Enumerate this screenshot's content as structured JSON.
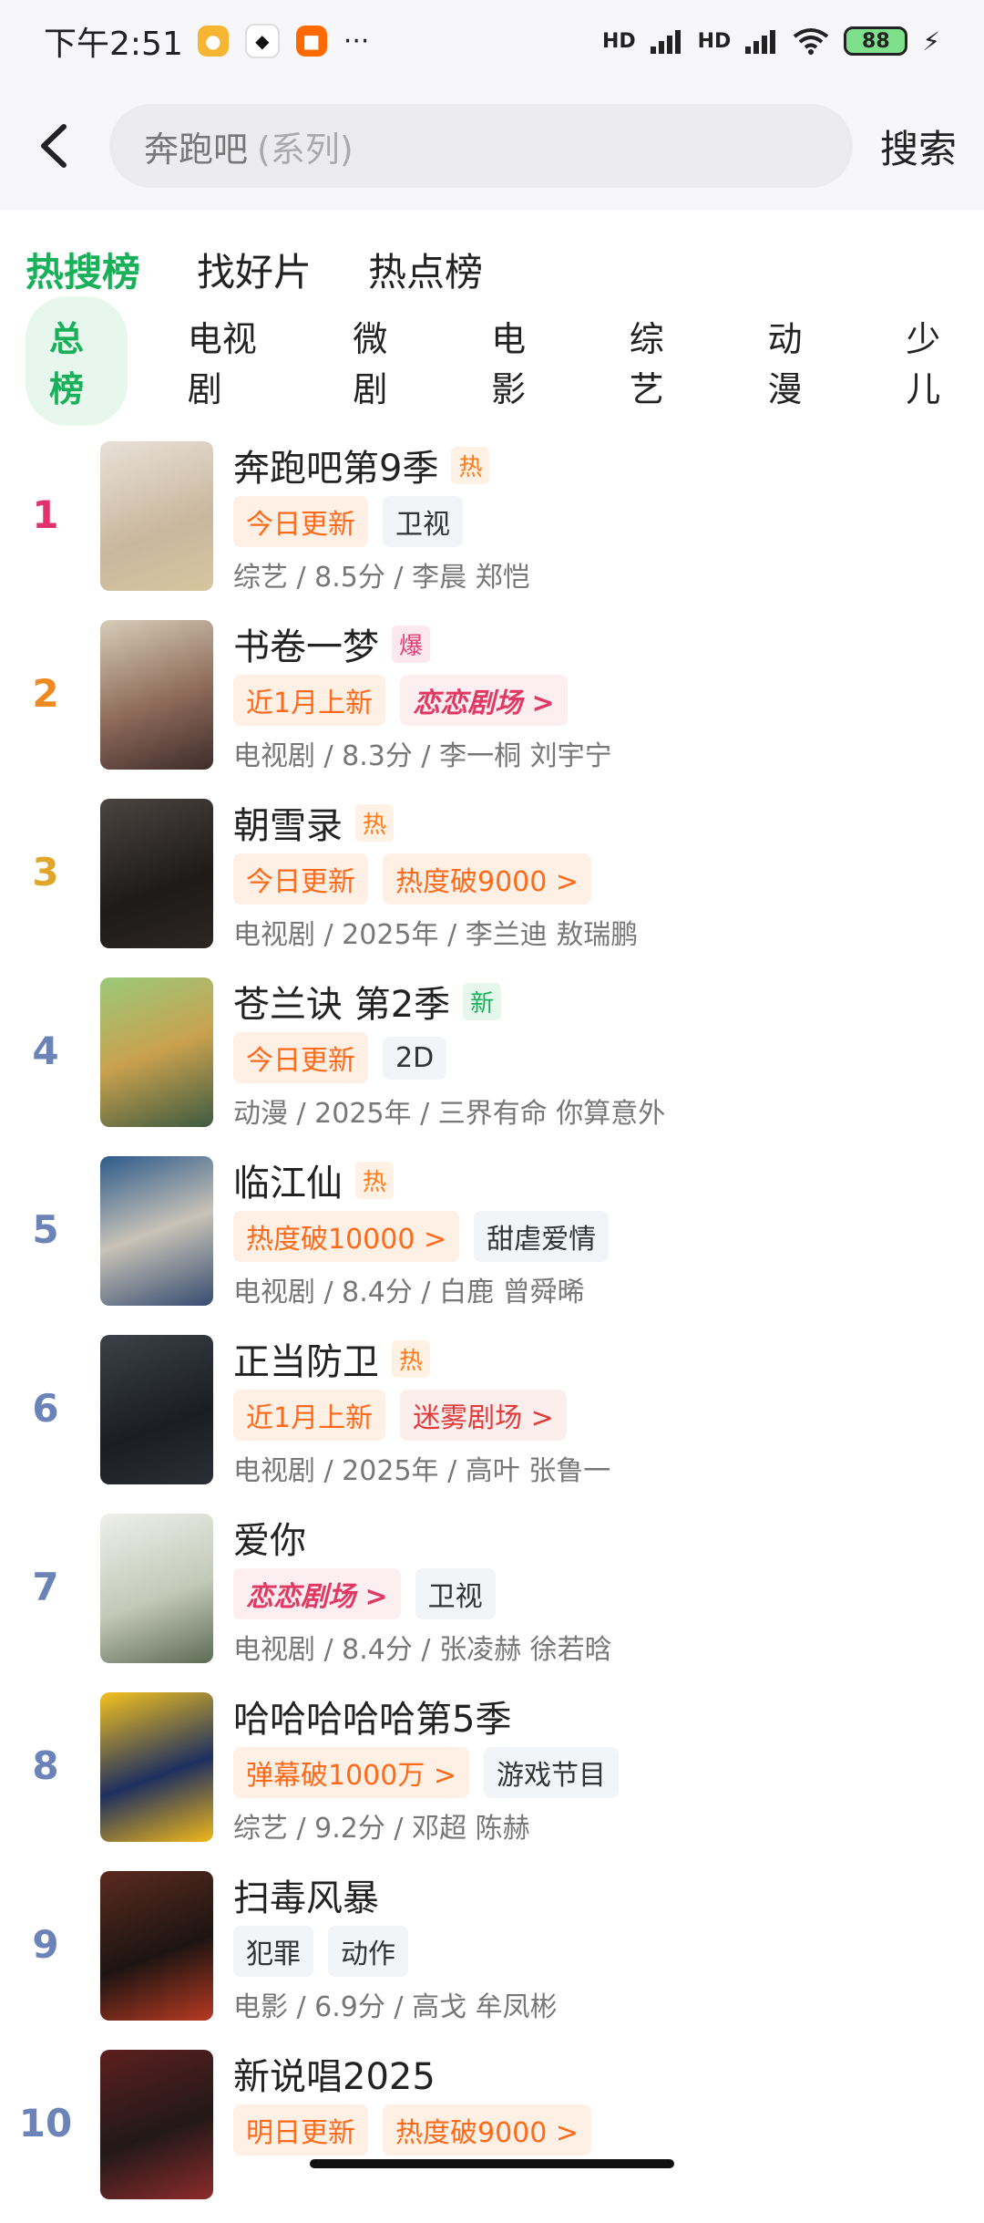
{
  "status_bar": {
    "time": "下午2:51",
    "battery": "88",
    "signal_hd1": "HD",
    "signal_hd2": "HD",
    "icons": [
      "weibo-icon",
      "qq-icon",
      "mi-icon",
      "more-icon",
      "signal-icon",
      "wifi-icon",
      "battery-icon",
      "charging-icon"
    ]
  },
  "search": {
    "query": "奔跑吧",
    "suffix": "(系列)",
    "button": "搜索"
  },
  "top_tabs": [
    "热搜榜",
    "找好片",
    "热点榜"
  ],
  "category_tabs": [
    "总榜",
    "电视剧",
    "微剧",
    "电影",
    "综艺",
    "动漫",
    "少儿"
  ],
  "list": [
    {
      "rank": "1",
      "title": "奔跑吧第9季",
      "badge": "热",
      "tags": [
        {
          "text": "今日更新",
          "style": "orange"
        },
        {
          "text": "卫视",
          "style": "gray"
        }
      ],
      "meta": "综艺 / 8.5分 / 李晨 郑恺"
    },
    {
      "rank": "2",
      "title": "书卷一梦",
      "badge": "爆",
      "tags": [
        {
          "text": "近1月上新",
          "style": "orange"
        },
        {
          "text": "恋恋剧场 >",
          "style": "pink"
        }
      ],
      "meta": "电视剧 / 8.3分 / 李一桐 刘宇宁"
    },
    {
      "rank": "3",
      "title": "朝雪录",
      "badge": "热",
      "tags": [
        {
          "text": "今日更新",
          "style": "orange"
        },
        {
          "text": "热度破9000 >",
          "style": "orange"
        }
      ],
      "meta": "电视剧 / 2025年 / 李兰迪 敖瑞鹏"
    },
    {
      "rank": "4",
      "title": "苍兰诀 第2季",
      "badge": "新",
      "tags": [
        {
          "text": "今日更新",
          "style": "orange"
        },
        {
          "text": "2D",
          "style": "gray"
        }
      ],
      "meta": "动漫 / 2025年 / 三界有命 你算意外"
    },
    {
      "rank": "5",
      "title": "临江仙",
      "badge": "热",
      "tags": [
        {
          "text": "热度破10000 >",
          "style": "orange"
        },
        {
          "text": "甜虐爱情",
          "style": "gray"
        }
      ],
      "meta": "电视剧 / 8.4分 / 白鹿 曾舜晞"
    },
    {
      "rank": "6",
      "title": "正当防卫",
      "badge": "热",
      "tags": [
        {
          "text": "近1月上新",
          "style": "orange"
        },
        {
          "text": "迷雾剧场 >",
          "style": "red"
        }
      ],
      "meta": "电视剧 / 2025年 / 高叶 张鲁一"
    },
    {
      "rank": "7",
      "title": "爱你",
      "badge": "",
      "tags": [
        {
          "text": "恋恋剧场 >",
          "style": "pink"
        },
        {
          "text": "卫视",
          "style": "gray"
        }
      ],
      "meta": "电视剧 / 8.4分 / 张凌赫 徐若晗"
    },
    {
      "rank": "8",
      "title": "哈哈哈哈哈第5季",
      "badge": "",
      "tags": [
        {
          "text": "弹幕破1000万 >",
          "style": "orange"
        },
        {
          "text": "游戏节目",
          "style": "gray"
        }
      ],
      "meta": "综艺 / 9.2分 / 邓超 陈赫"
    },
    {
      "rank": "9",
      "title": "扫毒风暴",
      "badge": "",
      "tags": [
        {
          "text": "犯罪",
          "style": "gray"
        },
        {
          "text": "动作",
          "style": "gray"
        }
      ],
      "meta": "电影 / 6.9分 / 高戈 牟凤彬"
    },
    {
      "rank": "10",
      "title": "新说唱2025",
      "badge": "",
      "tags": [
        {
          "text": "明日更新",
          "style": "orange"
        },
        {
          "text": "热度破9000 >",
          "style": "orange"
        }
      ],
      "meta": ""
    }
  ]
}
